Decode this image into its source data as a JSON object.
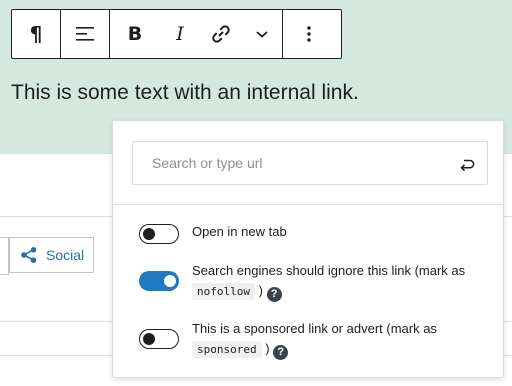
{
  "toolbar": {
    "paragraph_glyph": "¶",
    "bold_glyph": "B",
    "italic_glyph": "I"
  },
  "editor": {
    "text": "This is some text with an internal link."
  },
  "tabs": {
    "social_label": "Social"
  },
  "link_popover": {
    "search_placeholder": "Search or type url",
    "options": [
      {
        "label_before": "Open in new tab",
        "code": "",
        "label_after": "",
        "enabled": false
      },
      {
        "label_before": "Search engines should ignore this link (mark as",
        "code": "nofollow",
        "label_after": ")",
        "enabled": true
      },
      {
        "label_before": "This is a sponsored link or advert (mark as",
        "code": "sponsored",
        "label_after": ")",
        "enabled": false
      }
    ],
    "help_glyph": "?"
  },
  "colors": {
    "editor_background": "#d5e8e0",
    "toggle_on": "#1e7bc2",
    "link_blue": "#2271b1"
  }
}
